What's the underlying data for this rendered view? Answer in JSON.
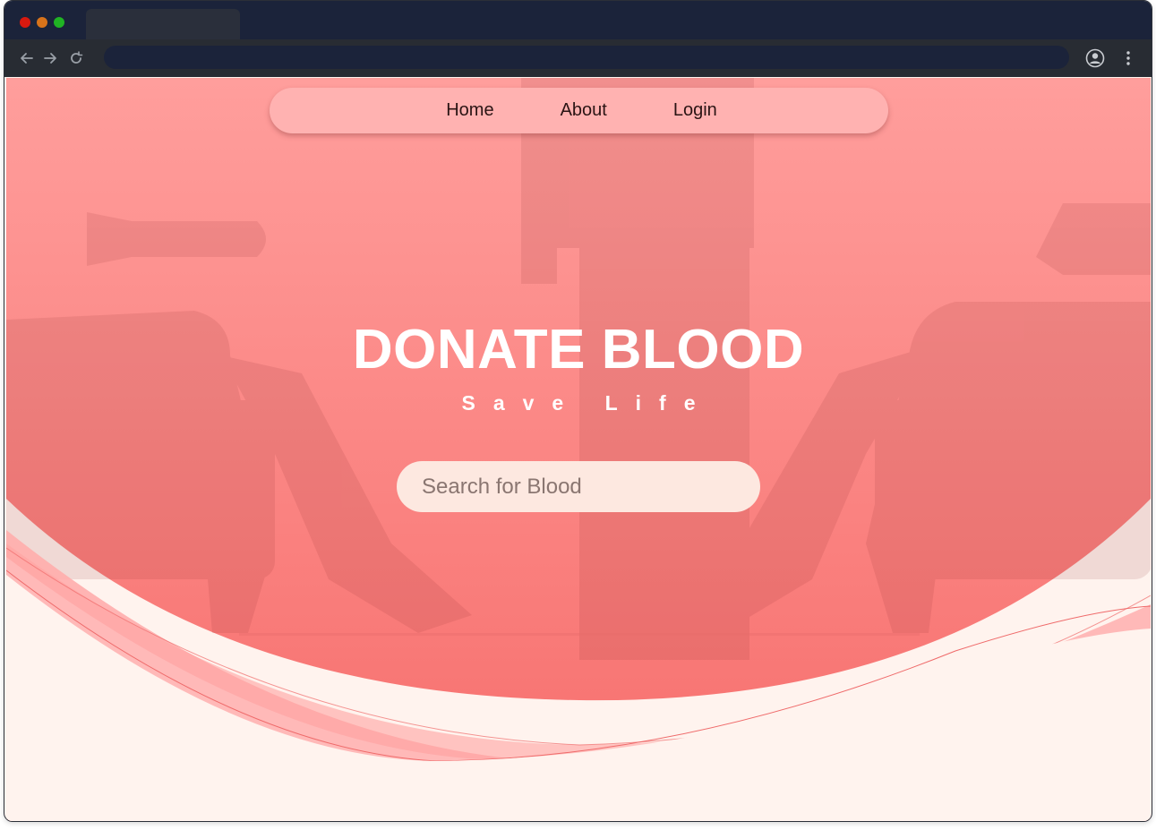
{
  "browser": {
    "icons": [
      "back-arrow-icon",
      "forward-arrow-icon",
      "reload-icon",
      "profile-icon",
      "kebab-menu-icon"
    ]
  },
  "nav": {
    "items": [
      {
        "label": "Home"
      },
      {
        "label": "About"
      },
      {
        "label": "Login"
      }
    ]
  },
  "hero": {
    "title": "DONATE BLOOD",
    "subtitle": "Save Life",
    "search_placeholder": "Search for Blood"
  },
  "colors": {
    "hero_top": "#ff9c9a",
    "hero_bottom": "#f77a78",
    "wave_light": "#ffb3b2",
    "page_bg": "#fff3ee",
    "browser_chrome": "#1b233a"
  }
}
